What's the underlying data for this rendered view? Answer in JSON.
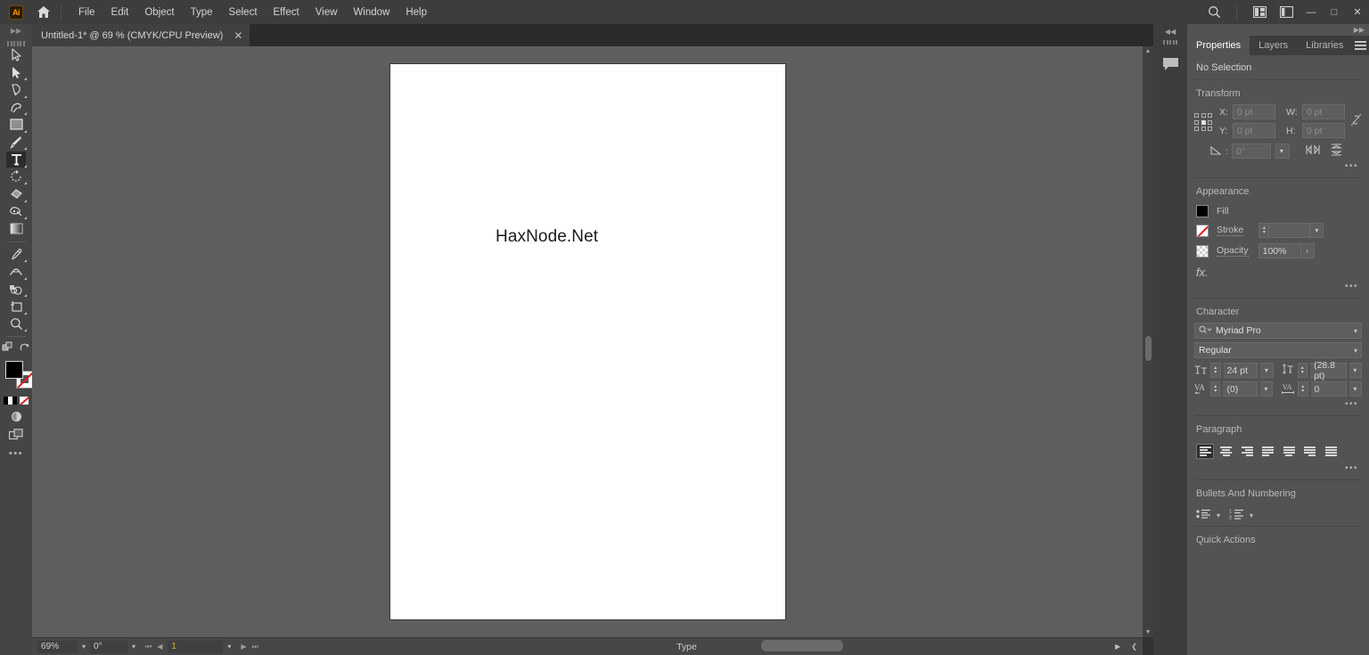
{
  "app": {
    "name": "Adobe Illustrator",
    "logo_text": "Ai",
    "home_icon": "home-icon"
  },
  "menubar": {
    "items": [
      {
        "label": "File"
      },
      {
        "label": "Edit"
      },
      {
        "label": "Object"
      },
      {
        "label": "Type"
      },
      {
        "label": "Select"
      },
      {
        "label": "Effect"
      },
      {
        "label": "View"
      },
      {
        "label": "Window"
      },
      {
        "label": "Help"
      }
    ],
    "right_icons": [
      {
        "name": "search-icon",
        "glyph": "search"
      },
      {
        "name": "arrange-documents-icon",
        "glyph": "arrange"
      },
      {
        "name": "workspace-switcher-icon",
        "glyph": "workspace"
      }
    ],
    "window_controls": {
      "minimize": "—",
      "maximize": "□",
      "close": "✕"
    }
  },
  "tabbar": {
    "document_tab": {
      "title": "Untitled-1* @ 69 % (CMYK/CPU Preview)",
      "close": "✕"
    }
  },
  "toolbar": {
    "tools": [
      {
        "name": "selection-tool",
        "label": "Selection",
        "active": false
      },
      {
        "name": "direct-selection-tool",
        "label": "Direct Selection",
        "active": false
      },
      {
        "name": "pen-tool",
        "label": "Pen",
        "active": false
      },
      {
        "name": "curvature-tool",
        "label": "Curvature",
        "active": false
      },
      {
        "name": "rectangle-tool",
        "label": "Rectangle",
        "active": false
      },
      {
        "name": "paintbrush-tool",
        "label": "Paintbrush",
        "active": false
      },
      {
        "name": "type-tool",
        "label": "Type",
        "active": true
      },
      {
        "name": "rotate-tool",
        "label": "Rotate",
        "active": false
      },
      {
        "name": "eraser-tool",
        "label": "Eraser",
        "active": false
      },
      {
        "name": "shaper-tool",
        "label": "Shaper",
        "active": false
      },
      {
        "name": "gradient-tool",
        "label": "Gradient",
        "active": false
      },
      {
        "name": "eyedropper-tool",
        "label": "Eyedropper",
        "active": false
      },
      {
        "name": "width-tool",
        "label": "Width",
        "active": false
      },
      {
        "name": "shape-builder-tool",
        "label": "Shape Builder",
        "active": false
      },
      {
        "name": "artboard-tool",
        "label": "Artboard",
        "active": false
      },
      {
        "name": "zoom-tool",
        "label": "Zoom",
        "active": false
      }
    ],
    "fill_color": "#000000",
    "stroke_color": "none",
    "edit_toolbar": "•••"
  },
  "canvas": {
    "artwork_text": "HaxNode.Net",
    "background_color": "#5e5e5e",
    "artboard_color": "#ffffff"
  },
  "statusbar": {
    "zoom": "69%",
    "rotation": "0°",
    "artboard_number": "1",
    "tool_status": "Type"
  },
  "properties_panel": {
    "tabs": [
      {
        "label": "Properties",
        "active": true
      },
      {
        "label": "Layers",
        "active": false
      },
      {
        "label": "Libraries",
        "active": false
      }
    ],
    "selection_status": "No Selection",
    "transform": {
      "title": "Transform",
      "x_label": "X:",
      "x_value": "0 pt",
      "y_label": "Y:",
      "y_value": "0 pt",
      "w_label": "W:",
      "w_value": "0 pt",
      "h_label": "H:",
      "h_value": "0 pt",
      "angle_value": "0°",
      "more_options": "•••"
    },
    "appearance": {
      "title": "Appearance",
      "fill_label": "Fill",
      "stroke_label": "Stroke",
      "stroke_weight": "",
      "opacity_label": "Opacity",
      "opacity_value": "100%",
      "fx_label": "fx.",
      "more_options": "•••"
    },
    "character": {
      "title": "Character",
      "font_family": "Myriad Pro",
      "font_style": "Regular",
      "font_size": "24 pt",
      "leading": "(28.8 pt)",
      "kerning": "(0)",
      "tracking": "0",
      "more_options": "•••"
    },
    "paragraph": {
      "title": "Paragraph",
      "align_options": [
        {
          "name": "align-left",
          "active": true
        },
        {
          "name": "align-center",
          "active": false
        },
        {
          "name": "align-right",
          "active": false
        },
        {
          "name": "justify-last-left",
          "active": false
        },
        {
          "name": "justify-last-center",
          "active": false
        },
        {
          "name": "justify-last-right",
          "active": false
        },
        {
          "name": "justify-all",
          "active": false
        }
      ],
      "more_options": "•••"
    },
    "bullets": {
      "title": "Bullets And Numbering"
    },
    "quick_actions": {
      "title": "Quick Actions"
    }
  }
}
